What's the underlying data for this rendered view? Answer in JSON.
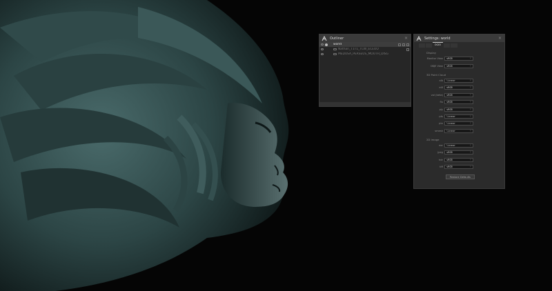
{
  "outliner": {
    "title": "Outliner",
    "rows": [
      {
        "name": "world",
        "selected": true
      },
      {
        "name": "Nathan_T1T1_TCW_ECEOO",
        "selected": false
      },
      {
        "name": "MEDUSA_PERSEUS_MOUTH_DISG",
        "selected": false
      }
    ]
  },
  "settings": {
    "title": "Settings: world",
    "tabs": [
      "",
      "",
      "OCIO",
      "",
      ""
    ],
    "sections": [
      {
        "header": "Display",
        "rows": [
          {
            "label": "Monitor View",
            "value": "sRGB"
          },
          {
            "label": "OBJE View",
            "value": "sRGB"
          }
        ]
      },
      {
        "header": "3D Point Cloud",
        "rows": [
          {
            "label": "alb",
            "value": "linear"
          },
          {
            "label": "elif",
            "value": "sRGB"
          },
          {
            "label": "vol (beta)",
            "value": "sRGB"
          },
          {
            "label": "flu",
            "value": "sRGB"
          },
          {
            "label": "ply",
            "value": "sRGB"
          },
          {
            "label": "pts",
            "value": "linear"
          },
          {
            "label": "ptx",
            "value": "linear"
          },
          {
            "label": "smesh",
            "value": "linear"
          }
        ]
      },
      {
        "header": "2D Image",
        "rows": [
          {
            "label": "exr",
            "value": "linear"
          },
          {
            "label": "jpeg",
            "value": "sRGB"
          },
          {
            "label": "hdr",
            "value": "sRGB"
          },
          {
            "label": "tiff",
            "value": "sRGB"
          }
        ]
      }
    ],
    "restore_label": "Restore Defaults"
  },
  "icons": {
    "app_logo": "app-logo-icon",
    "visibility": "eye-icon",
    "caret": "chevron-down-icon"
  },
  "colors": {
    "accent": "#cfcfcf",
    "panel": "#2b2b2b",
    "statue": "#2f4a4a"
  }
}
